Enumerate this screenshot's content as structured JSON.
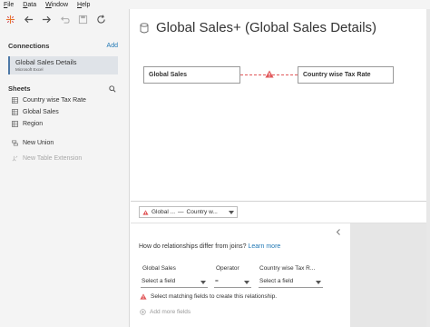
{
  "menu": [
    "File",
    "Data",
    "Window",
    "Help"
  ],
  "toolbar": {
    "icons": [
      "tableau-logo-icon",
      "back-arrow-icon",
      "forward-arrow-icon",
      "undo-icon",
      "save-icon",
      "refresh-icon"
    ]
  },
  "connections": {
    "title": "Connections",
    "add_label": "Add",
    "items": [
      {
        "name": "Global Sales Details",
        "type": "Microsoft Excel"
      }
    ]
  },
  "sheets": {
    "title": "Sheets",
    "items": [
      "Country wise Tax Rate",
      "Global Sales",
      "Region"
    ],
    "new_union": "New Union",
    "new_table_extension": "New Table Extension"
  },
  "canvas": {
    "title": "Global Sales+ (Global Sales Details)",
    "left_table": "Global Sales",
    "right_table": "Country wise Tax Rate"
  },
  "relationship": {
    "tab_left": "Global ...",
    "tab_right": "Country w...",
    "question": "How do relationships differ from joins?",
    "learn_more": "Learn more",
    "col_left_label": "Global Sales",
    "col_op_label": "Operator",
    "col_right_label": "Country wise Tax R...",
    "left_field": "Select a field",
    "operator": "=",
    "right_field": "Select a field",
    "message": "Select matching fields to create this relationship.",
    "add_more": "Add more fields"
  },
  "colors": {
    "accent": "#1f77b4",
    "warning": "#e15759",
    "panel_bg": "#f4f4f4"
  }
}
